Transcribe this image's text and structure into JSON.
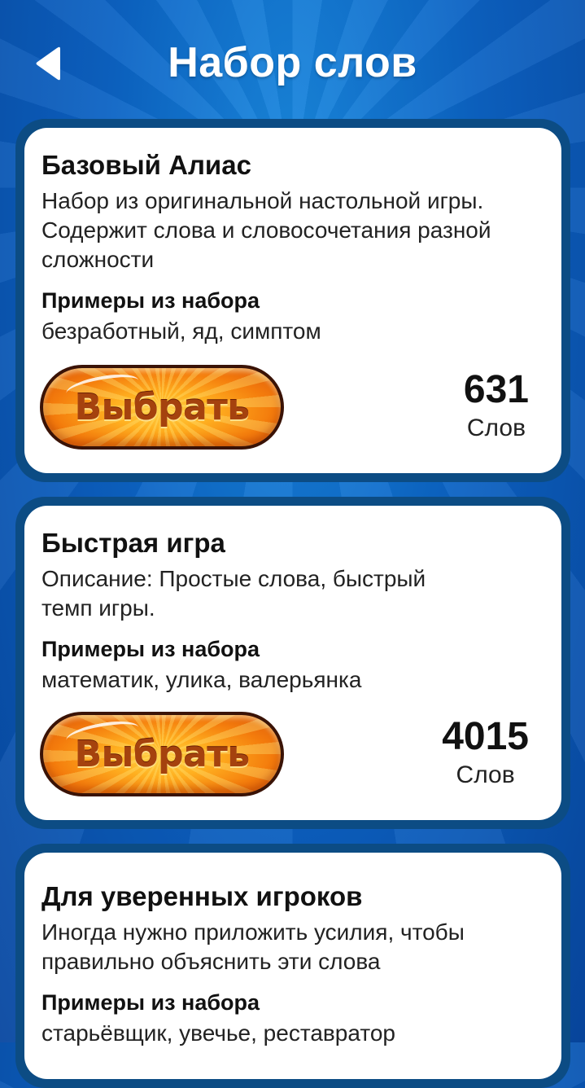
{
  "header": {
    "title": "Набор слов",
    "back_icon": "back-arrow-icon"
  },
  "colors": {
    "background": "#0c63c4",
    "card_border": "#0c4c84",
    "button_orange": "#f47c0c",
    "button_text": "#a5420e"
  },
  "word_sets": [
    {
      "title": "Базовый Алиас",
      "description": "Набор из оригинальной настольной игры. Содержит слова и словосочетания разной сложности",
      "examples_label": "Примеры из набора",
      "examples": "безработный, яд, симптом",
      "button_label": "Выбрать",
      "count": "631",
      "count_unit": "Слов"
    },
    {
      "title": "Быстрая игра",
      "description": "Описание: Простые слова, быстрый темп игры.",
      "examples_label": "Примеры из набора",
      "examples": "математик, улика, валерьянка",
      "button_label": "Выбрать",
      "count": "4015",
      "count_unit": "Слов"
    },
    {
      "title": "Для уверенных игроков",
      "description": "Иногда нужно приложить усилия, чтобы правильно объяснить эти слова",
      "examples_label": "Примеры из набора",
      "examples": "старьёвщик, увечье, реставратор"
    }
  ]
}
